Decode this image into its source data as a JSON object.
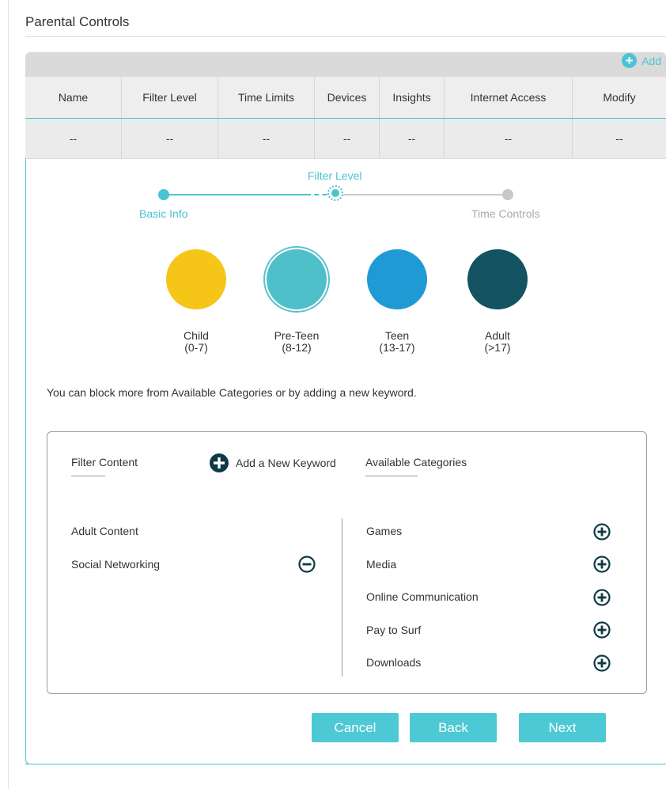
{
  "page": {
    "title": "Parental Controls"
  },
  "table": {
    "add_label": "Add",
    "columns": [
      "Name",
      "Filter Level",
      "Time Limits",
      "Devices",
      "Insights",
      "Internet Access",
      "Modify"
    ],
    "row": [
      "--",
      "--",
      "--",
      "--",
      "--",
      "--",
      "--"
    ]
  },
  "stepper": {
    "steps": [
      {
        "label": "Basic Info",
        "state": "done"
      },
      {
        "label": "Filter Level",
        "state": "current"
      },
      {
        "label": "Time Controls",
        "state": "pending"
      }
    ],
    "colors": {
      "active": "#4cc3d3",
      "inactive": "#c8c8c8",
      "inactive_text": "#aaaaaa"
    }
  },
  "levels": [
    {
      "name": "Child",
      "range": "(0-7)",
      "color": "#f5c518",
      "selected": false
    },
    {
      "name": "Pre-Teen",
      "range": "(8-12)",
      "color": "#4fbfca",
      "selected": true
    },
    {
      "name": "Teen",
      "range": "(13-17)",
      "color": "#1f9ad4",
      "selected": false
    },
    {
      "name": "Adult",
      "range": "(>17)",
      "color": "#135362",
      "selected": false
    }
  ],
  "hint": "You can block more from Available Categories or by adding a new keyword.",
  "filter": {
    "filter_content_label": "Filter Content",
    "add_keyword_label": "Add a New Keyword",
    "available_label": "Available Categories",
    "blocked": [
      "Adult Content",
      "Social Networking"
    ],
    "available": [
      "Games",
      "Media",
      "Online Communication",
      "Pay to Surf",
      "Downloads"
    ]
  },
  "buttons": {
    "cancel": "Cancel",
    "back": "Back",
    "next": "Next"
  },
  "icons": {
    "add": "plus-circle-icon",
    "remove": "minus-circle-icon"
  },
  "colors": {
    "accent": "#4cc3d3",
    "button": "#4cc9d5",
    "icon_dark": "#0e3a46"
  }
}
